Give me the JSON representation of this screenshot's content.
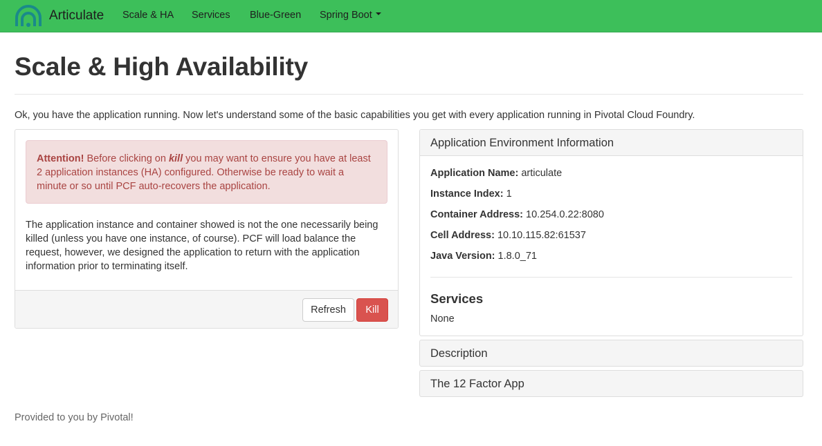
{
  "navbar": {
    "brand": "Articulate",
    "logo_icon": "pivotal-rings-logo",
    "links": [
      "Scale & HA",
      "Services",
      "Blue-Green",
      "Spring Boot"
    ],
    "bg_color": "#3dbf5a"
  },
  "page": {
    "title": "Scale & High Availability",
    "intro": "Ok, you have the application running. Now let's understand some of the basic capabilities you get with every application running in Pivotal Cloud Foundry."
  },
  "kill_panel": {
    "alert_strong": "Attention!",
    "alert_before": " Before clicking on ",
    "alert_em": "kill",
    "alert_after": " you may want to ensure you have at least 2 application instances (HA) configured. Otherwise be ready to wait a minute or so until PCF auto-recovers the application.",
    "body": "The application instance and container showed is not the one necessarily being killed (unless you have one instance, of course). PCF will load balance the request, however, we designed the application to return with the application information prior to terminating itself.",
    "refresh_label": "Refresh",
    "kill_label": "Kill"
  },
  "env_panel": {
    "heading": "Application Environment Information",
    "rows": [
      {
        "label": "Application Name:",
        "value": " articulate"
      },
      {
        "label": "Instance Index:",
        "value": " 1"
      },
      {
        "label": "Container Address:",
        "value": " 10.254.0.22:8080"
      },
      {
        "label": "Cell Address:",
        "value": " 10.10.115.82:61537"
      },
      {
        "label": "Java Version:",
        "value": " 1.8.0_71"
      }
    ],
    "services_title": "Services",
    "services_value": "None"
  },
  "collapsed_panels": {
    "description": "Description",
    "twelve_factor": "The 12 Factor App"
  },
  "footer": {
    "text": "Provided to you by Pivotal!"
  }
}
